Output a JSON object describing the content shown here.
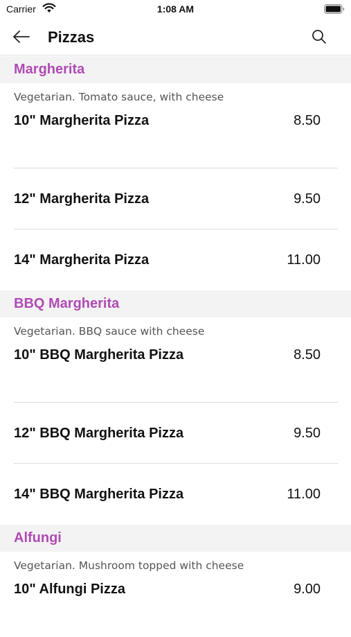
{
  "status_bar": {
    "carrier": "Carrier",
    "time": "1:08 AM"
  },
  "nav": {
    "title": "Pizzas",
    "back_icon": "arrow-left-icon",
    "search_icon": "search-icon"
  },
  "colors": {
    "section_title": "#b04bb4",
    "section_bg": "#f3f3f3"
  },
  "sections": [
    {
      "title": "Margherita",
      "description": "Vegetarian. Tomato sauce, with cheese",
      "items": [
        {
          "name": "10\" Margherita Pizza",
          "price": "8.50"
        },
        {
          "name": "12\" Margherita Pizza",
          "price": "9.50"
        },
        {
          "name": "14\" Margherita Pizza",
          "price": "11.00"
        }
      ]
    },
    {
      "title": "BBQ Margherita",
      "description": "Vegetarian. BBQ sauce with cheese",
      "items": [
        {
          "name": "10\" BBQ Margherita Pizza",
          "price": "8.50"
        },
        {
          "name": "12\" BBQ Margherita Pizza",
          "price": "9.50"
        },
        {
          "name": "14\" BBQ Margherita Pizza",
          "price": "11.00"
        }
      ]
    },
    {
      "title": "Alfungi",
      "description": "Vegetarian. Mushroom topped with cheese",
      "items": [
        {
          "name": "10\" Alfungi Pizza",
          "price": "9.00"
        }
      ]
    }
  ]
}
